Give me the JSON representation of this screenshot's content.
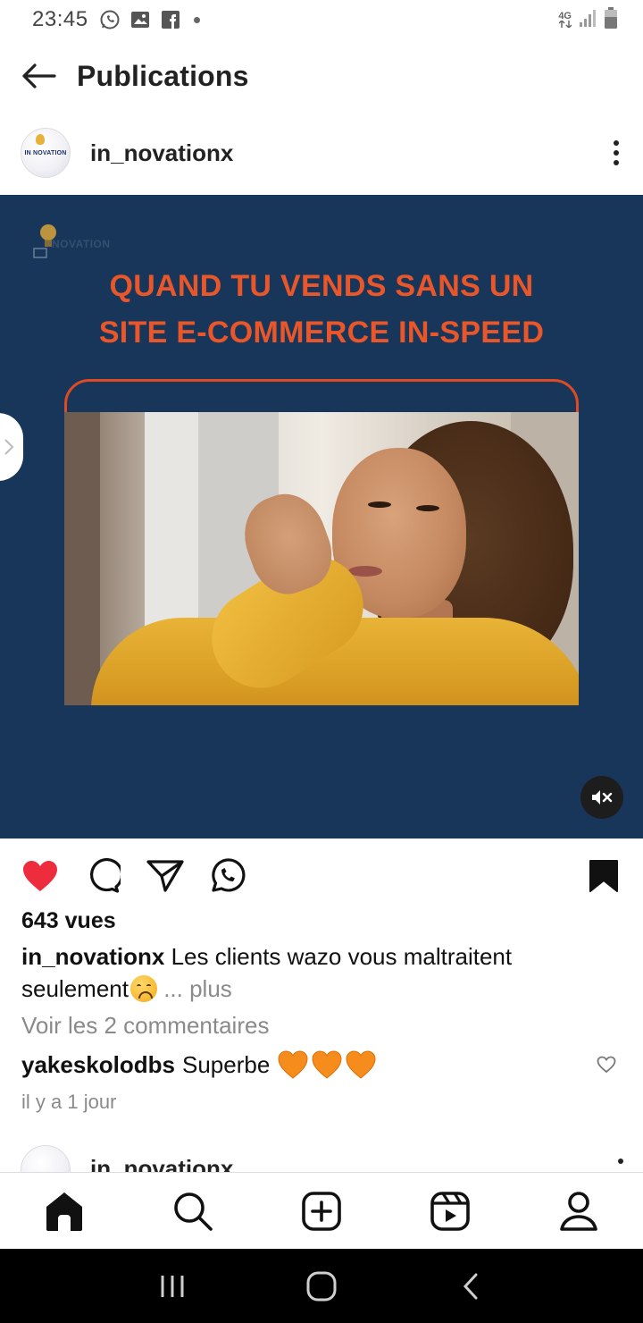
{
  "status_bar": {
    "time": "23:45",
    "network": "4G",
    "icons_left": [
      "whatsapp-icon",
      "gallery-icon",
      "facebook-icon",
      "dot-icon"
    ],
    "icons_right": [
      "4g-icon",
      "signal-icon",
      "battery-icon"
    ]
  },
  "header": {
    "title": "Publications"
  },
  "post": {
    "username": "in_novationx",
    "avatar_text": "IN NOVATION",
    "media": {
      "logo_text": "NOVATION",
      "headline_line1": "QUAND TU VENDS SANS UN",
      "headline_line2": "SITE E-COMMERCE IN-SPEED",
      "muted": true
    },
    "views": "643 vues",
    "caption_user": "in_novationx",
    "caption_text": "Les clients wazo vous maltraitent seulement",
    "caption_more": "... plus",
    "view_comments": "Voir les 2 commentaires",
    "comment": {
      "user": "yakeskolodbs",
      "text": "Superbe"
    },
    "time_ago": "il y a 1 jour",
    "liked": true,
    "saved": true
  },
  "next_post": {
    "username": "in_novationx"
  },
  "bottom_nav": [
    "home-icon",
    "search-icon",
    "create-icon",
    "reels-icon",
    "profile-icon"
  ],
  "colors": {
    "like_red": "#ed2d3d",
    "media_bg": "#18365a",
    "headline_orange": "#e9562a",
    "heart_orange": "#f58c1b"
  }
}
